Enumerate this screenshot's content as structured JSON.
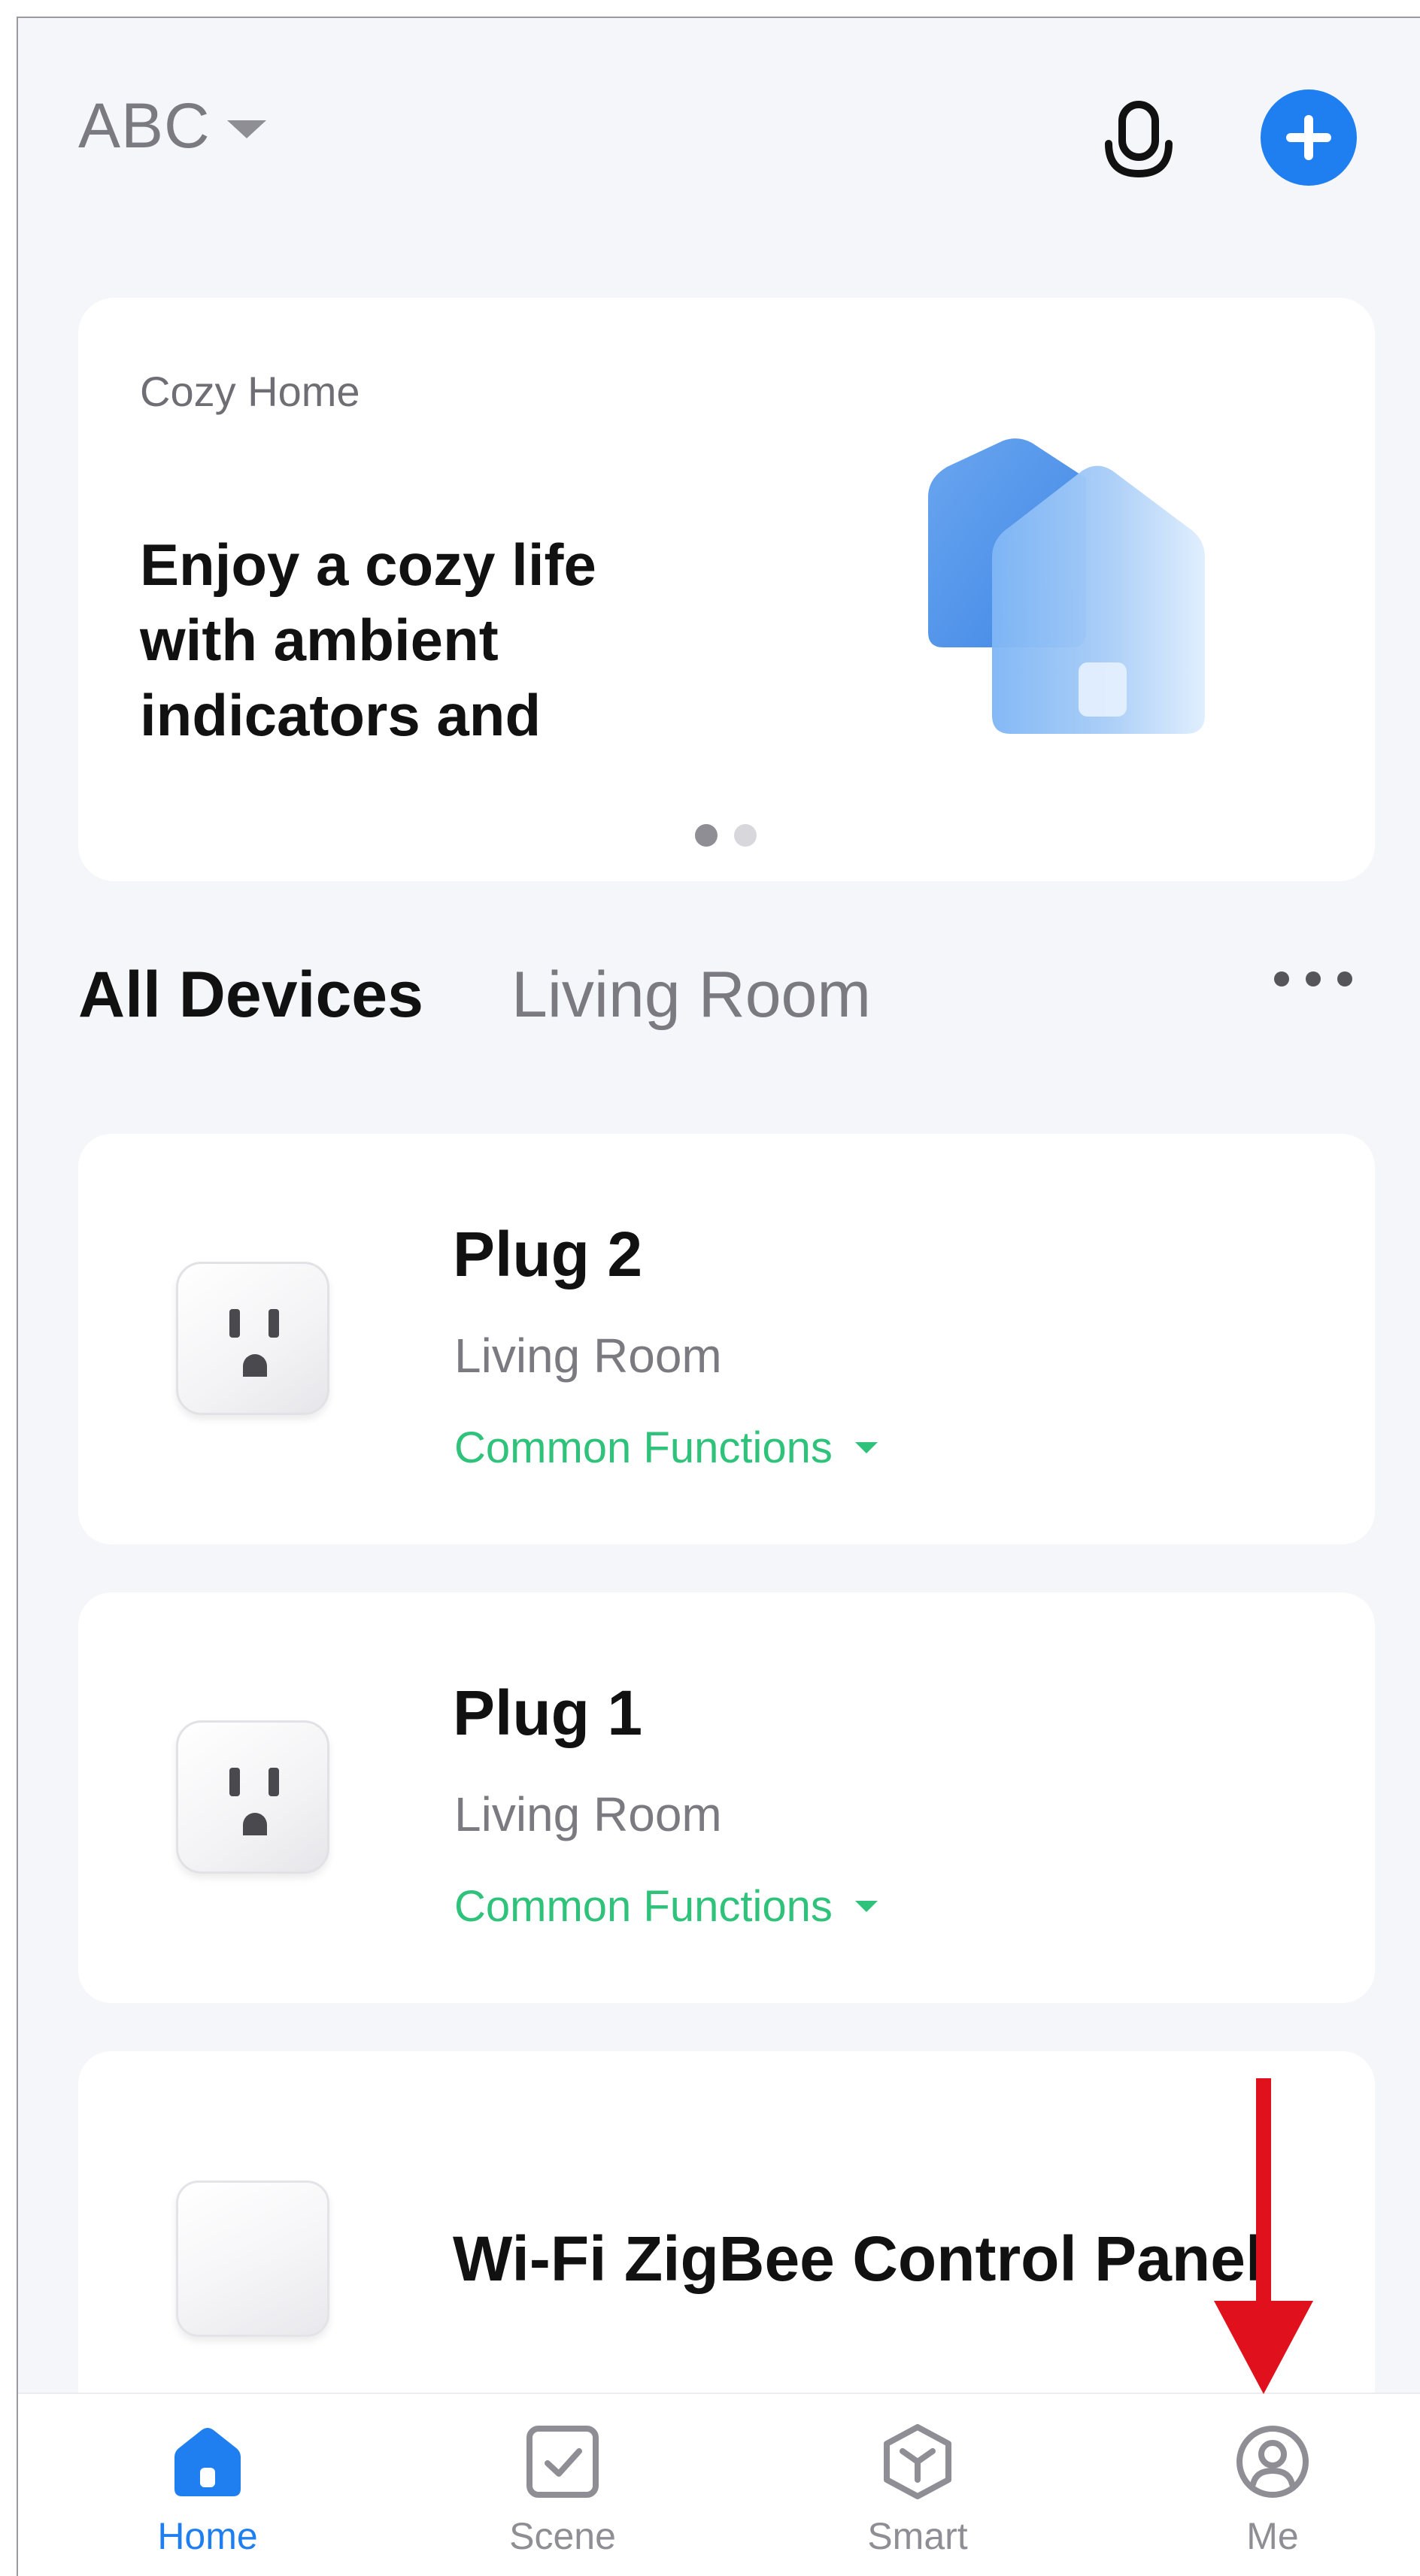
{
  "header": {
    "home_name": "ABC",
    "icons": [
      "chevron-down-icon",
      "microphone-icon",
      "add-icon"
    ]
  },
  "banner": {
    "subtitle": "Cozy Home",
    "title": "Enjoy a cozy life with ambient indicators and",
    "art": "house-illustration",
    "page_count": 2,
    "active_page": 1
  },
  "tabs": {
    "items": [
      "All Devices",
      "Living Room"
    ],
    "active": "All Devices",
    "more_icon": "more-icon"
  },
  "devices": [
    {
      "name": "Plug 2",
      "room": "Living Room",
      "functions_label": "Common Functions",
      "icon": "plug-icon"
    },
    {
      "name": "Plug 1",
      "room": "Living Room",
      "functions_label": "Common Functions",
      "icon": "plug-icon"
    },
    {
      "name": "Wi-Fi ZigBee Control Panel",
      "icon": "control-panel-icon"
    }
  ],
  "bottom_nav": {
    "items": [
      {
        "label": "Home",
        "icon": "home-icon",
        "active": true
      },
      {
        "label": "Scene",
        "icon": "scene-checkbox-icon",
        "active": false
      },
      {
        "label": "Smart",
        "icon": "smart-cube-icon",
        "active": false
      },
      {
        "label": "Me",
        "icon": "user-profile-icon",
        "active": false
      }
    ]
  },
  "annotation": {
    "type": "red-arrow",
    "points_to": "Me"
  },
  "colors": {
    "accent": "#1f7ff0",
    "functions": "#2fc27a",
    "background": "#f4f6fa",
    "annotation": "#e0101c"
  }
}
